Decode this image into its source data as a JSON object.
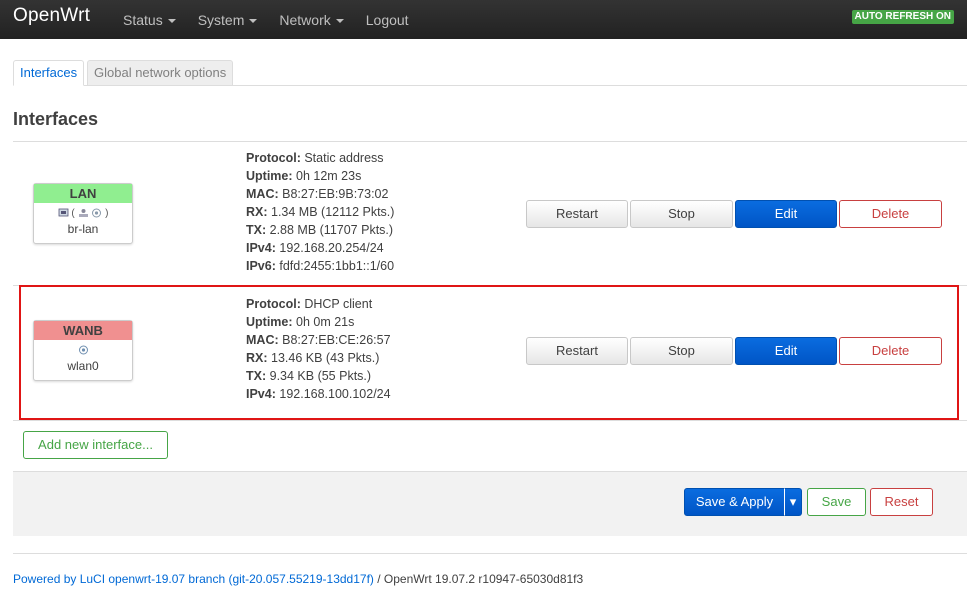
{
  "navbar": {
    "brand": "OpenWrt",
    "menu": [
      "Status",
      "System",
      "Network",
      "Logout"
    ],
    "auto_refresh": "AUTO REFRESH ON"
  },
  "tabs": {
    "interfaces": "Interfaces",
    "global": "Global network options"
  },
  "page_title": "Interfaces",
  "interfaces": [
    {
      "name": "LAN",
      "color": "#90ee90",
      "device": "br-lan",
      "info": [
        {
          "k": "Protocol:",
          "v": " Static address"
        },
        {
          "k": "Uptime:",
          "v": " 0h 12m 23s"
        },
        {
          "k": "MAC:",
          "v": " B8:27:EB:9B:73:02"
        },
        {
          "k": "RX:",
          "v": " 1.34 MB (12112 Pkts.)"
        },
        {
          "k": "TX:",
          "v": " 2.88 MB (11707 Pkts.)"
        },
        {
          "k": "IPv4:",
          "v": " 192.168.20.254/24"
        },
        {
          "k": "IPv6:",
          "v": " fdfd:2455:1bb1::1/60"
        }
      ]
    },
    {
      "name": "WANB",
      "color": "#f09090",
      "device": "wlan0",
      "info": [
        {
          "k": "Protocol:",
          "v": " DHCP client"
        },
        {
          "k": "Uptime:",
          "v": " 0h 0m 21s"
        },
        {
          "k": "MAC:",
          "v": " B8:27:EB:CE:26:57"
        },
        {
          "k": "RX:",
          "v": " 13.46 KB (43 Pkts.)"
        },
        {
          "k": "TX:",
          "v": " 9.34 KB (55 Pkts.)"
        },
        {
          "k": "IPv4:",
          "v": " 192.168.100.102/24"
        }
      ]
    }
  ],
  "row_buttons": {
    "restart": "Restart",
    "stop": "Stop",
    "edit": "Edit",
    "delete": "Delete"
  },
  "add_interface": "Add new interface...",
  "footer_buttons": {
    "save_apply": "Save & Apply",
    "dropdown": "▾",
    "save": "Save",
    "reset": "Reset"
  },
  "powered": {
    "link": "Powered by LuCI openwrt-19.07 branch (git-20.057.55219-13dd17f)",
    "text": " / OpenWrt 19.07.2 r10947-65030d81f3"
  },
  "colors": {
    "accent": "#0069d6",
    "highlight": "#e01515",
    "success": "#46a546",
    "danger": "#c84040"
  }
}
